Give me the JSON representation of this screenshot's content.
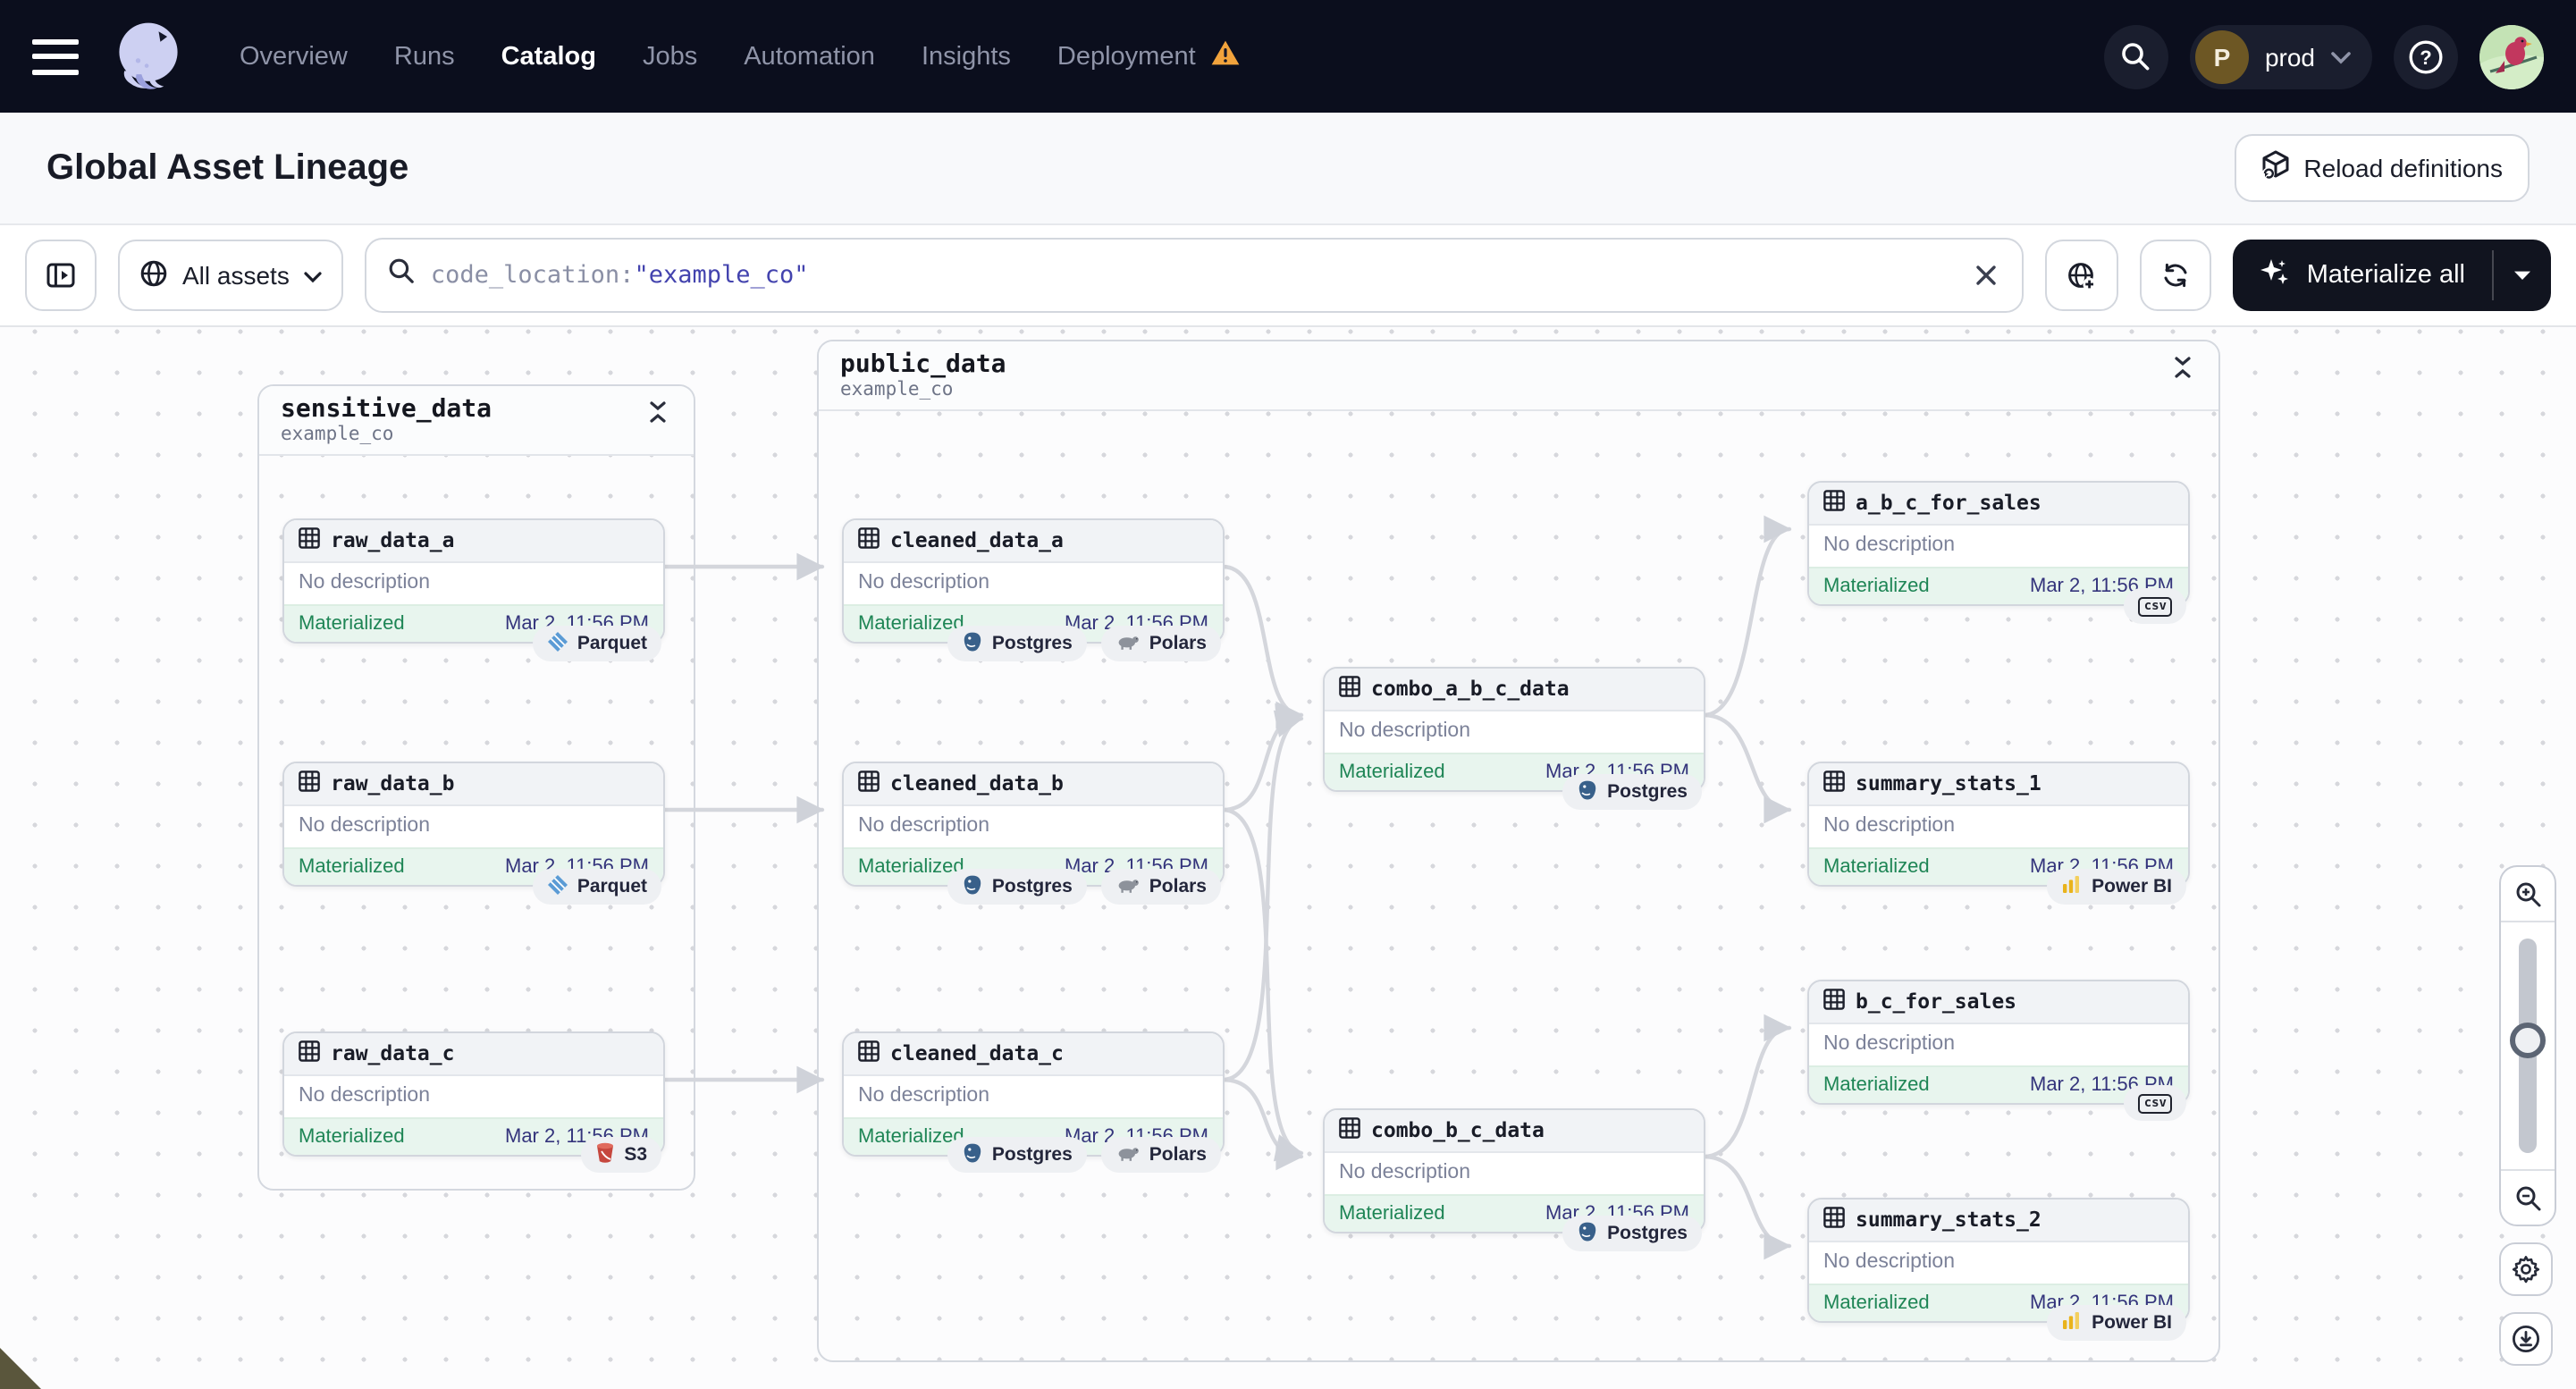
{
  "nav": {
    "items": [
      "Overview",
      "Runs",
      "Catalog",
      "Jobs",
      "Automation",
      "Insights",
      "Deployment"
    ],
    "active_item": "Catalog",
    "environment": {
      "initial": "P",
      "name": "prod"
    },
    "help_glyph": "?"
  },
  "header": {
    "title": "Global Asset Lineage",
    "reload_button": "Reload definitions"
  },
  "toolbar": {
    "asset_filter_label": "All assets",
    "search": {
      "prefix": "code_location:",
      "quoted": "\"example_co\""
    },
    "materialize_label": "Materialize all"
  },
  "canvas": {
    "groups": [
      {
        "name": "sensitive_data",
        "location": "example_co"
      },
      {
        "name": "public_data",
        "location": "example_co"
      }
    ],
    "nodes": [
      {
        "name": "raw_data_a",
        "description": "No description",
        "status": "Materialized",
        "timestamp": "Mar 2, 11:56 PM",
        "tags": [
          {
            "icon": "parquet-icon",
            "label": "Parquet"
          }
        ]
      },
      {
        "name": "raw_data_b",
        "description": "No description",
        "status": "Materialized",
        "timestamp": "Mar 2, 11:56 PM",
        "tags": [
          {
            "icon": "parquet-icon",
            "label": "Parquet"
          }
        ]
      },
      {
        "name": "raw_data_c",
        "description": "No description",
        "status": "Materialized",
        "timestamp": "Mar 2, 11:56 PM",
        "tags": [
          {
            "icon": "s3-icon",
            "label": "S3"
          }
        ]
      },
      {
        "name": "cleaned_data_a",
        "description": "No description",
        "status": "Materialized",
        "timestamp": "Mar 2, 11:56 PM",
        "tags": [
          {
            "icon": "postgres-icon",
            "label": "Postgres"
          },
          {
            "icon": "polars-icon",
            "label": "Polars"
          }
        ]
      },
      {
        "name": "cleaned_data_b",
        "description": "No description",
        "status": "Materialized",
        "timestamp": "Mar 2, 11:56 PM",
        "tags": [
          {
            "icon": "postgres-icon",
            "label": "Postgres"
          },
          {
            "icon": "polars-icon",
            "label": "Polars"
          }
        ]
      },
      {
        "name": "cleaned_data_c",
        "description": "No description",
        "status": "Materialized",
        "timestamp": "Mar 2, 11:56 PM",
        "tags": [
          {
            "icon": "postgres-icon",
            "label": "Postgres"
          },
          {
            "icon": "polars-icon",
            "label": "Polars"
          }
        ]
      },
      {
        "name": "combo_a_b_c_data",
        "description": "No description",
        "status": "Materialized",
        "timestamp": "Mar 2, 11:56 PM",
        "tags": [
          {
            "icon": "postgres-icon",
            "label": "Postgres"
          }
        ]
      },
      {
        "name": "combo_b_c_data",
        "description": "No description",
        "status": "Materialized",
        "timestamp": "Mar 2, 11:56 PM",
        "tags": [
          {
            "icon": "postgres-icon",
            "label": "Postgres"
          }
        ]
      },
      {
        "name": "a_b_c_for_sales",
        "description": "No description",
        "status": "Materialized",
        "timestamp": "Mar 2, 11:56 PM",
        "tags": [
          {
            "icon": "csv-icon",
            "label": "csv"
          }
        ]
      },
      {
        "name": "summary_stats_1",
        "description": "No description",
        "status": "Materialized",
        "timestamp": "Mar 2, 11:56 PM",
        "tags": [
          {
            "icon": "powerbi-icon",
            "label": "Power BI"
          }
        ]
      },
      {
        "name": "b_c_for_sales",
        "description": "No description",
        "status": "Materialized",
        "timestamp": "Mar 2, 11:56 PM",
        "tags": [
          {
            "icon": "csv-icon",
            "label": "csv"
          }
        ]
      },
      {
        "name": "summary_stats_2",
        "description": "No description",
        "status": "Materialized",
        "timestamp": "Mar 2, 11:56 PM",
        "tags": [
          {
            "icon": "powerbi-icon",
            "label": "Power BI"
          }
        ]
      }
    ]
  },
  "colors": {
    "nav_bg": "#0b0e1d",
    "materialized_green": "#1e8555",
    "timestamp_indigo": "#34347c",
    "warning_orange": "#f2a33c",
    "search_quoted": "#4343ae",
    "dark_button": "#11141f"
  }
}
